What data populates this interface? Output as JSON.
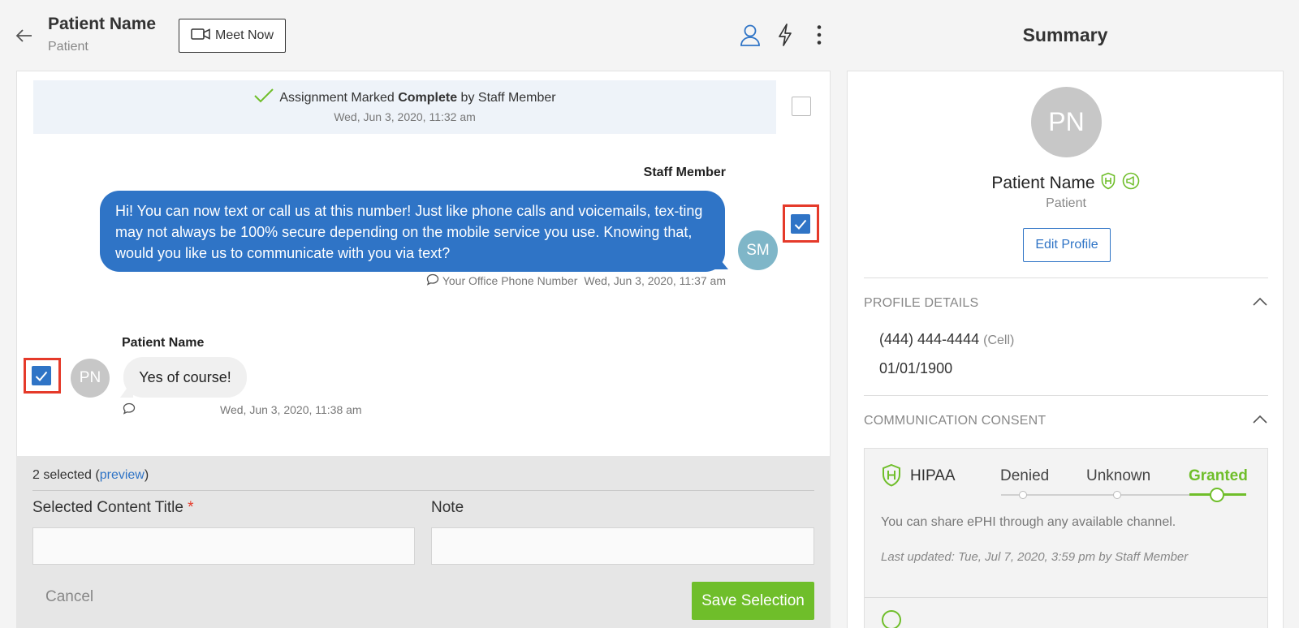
{
  "header": {
    "title": "Patient Name",
    "subtitle": "Patient",
    "meet_button": "Meet Now",
    "summary_title": "Summary"
  },
  "chat": {
    "event": {
      "prefix": "Assignment Marked",
      "bold": "Complete",
      "suffix": "by Staff Member",
      "time": "Wed, Jun 3, 2020, 11:32 am",
      "selected": false
    },
    "outgoing": {
      "sender": "Staff Member",
      "text": "Hi! You can now text or call us at this number! Just like phone calls and voicemails, tex-ting may not always be 100% secure depending on the mobile service you use. Knowing that, would you like us to communicate with you via text?",
      "avatar": "SM",
      "channel": "Your Office Phone Number",
      "time": "Wed, Jun 3, 2020, 11:37 am",
      "selected": true
    },
    "incoming": {
      "sender": "Patient Name",
      "text": "Yes of course!",
      "avatar": "PN",
      "time": "Wed, Jun 3, 2020, 11:38 am",
      "selected": true
    }
  },
  "selection": {
    "count_text": "2 selected (",
    "preview_label": "preview",
    "close_paren": ")",
    "title_label": "Selected Content Title",
    "required_mark": "*",
    "title_value": "",
    "note_label": "Note",
    "note_value": "",
    "cancel_label": "Cancel",
    "save_label": "Save Selection"
  },
  "profile": {
    "avatar": "PN",
    "name": "Patient Name",
    "role": "Patient",
    "edit_label": "Edit Profile",
    "details_header": "PROFILE DETAILS",
    "phone": "(444) 444-4444",
    "phone_type": "(Cell)",
    "dob": "01/01/1900",
    "consent_header": "COMMUNICATION CONSENT",
    "hipaa": {
      "label": "HIPAA",
      "options": [
        "Denied",
        "Unknown",
        "Granted"
      ],
      "selected": "Granted",
      "description": "You can share ePHI through any available channel.",
      "updated": "Last updated: Tue, Jul 7, 2020, 3:59 pm by Staff Member"
    }
  },
  "colors": {
    "accent": "#2f74c6",
    "success": "#6fbe2a",
    "highlight": "#e53a2a"
  },
  "icons": {
    "back": "arrow-left-icon",
    "video": "video-camera-icon",
    "contact": "user-icon",
    "quick": "lightning-icon",
    "more": "more-vertical-icon",
    "check": "checkmark-icon",
    "chat": "chat-bubble-icon",
    "hipaa": "shield-h-icon",
    "marketing": "megaphone-shield-icon",
    "collapse": "chevron-up-icon"
  }
}
